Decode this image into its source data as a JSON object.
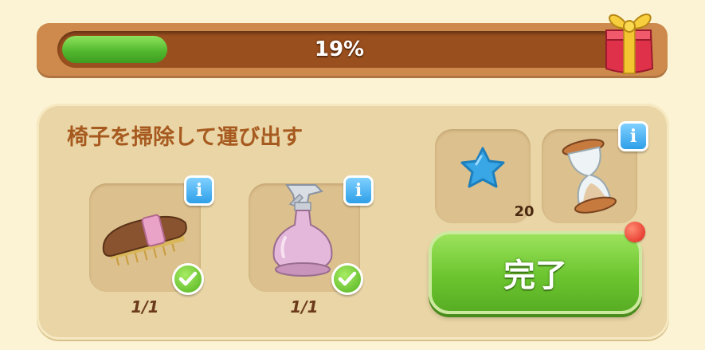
{
  "progress": {
    "value": 0.19,
    "label": "19%"
  },
  "task": {
    "title": "椅子を掃除して運び出す",
    "items": [
      {
        "icon": "brush-icon",
        "count": "1/1",
        "completed": true
      },
      {
        "icon": "spray-bottle-icon",
        "count": "1/1",
        "completed": true
      }
    ]
  },
  "rewards": {
    "star": {
      "icon": "blue-star-icon",
      "count": "20"
    },
    "timer": {
      "icon": "hourglass-icon"
    }
  },
  "complete_button": {
    "label": "完了"
  },
  "colors": {
    "accent_green": "#6cc52f",
    "info_blue": "#2e9fe8",
    "title_brown": "#a75a1f"
  }
}
